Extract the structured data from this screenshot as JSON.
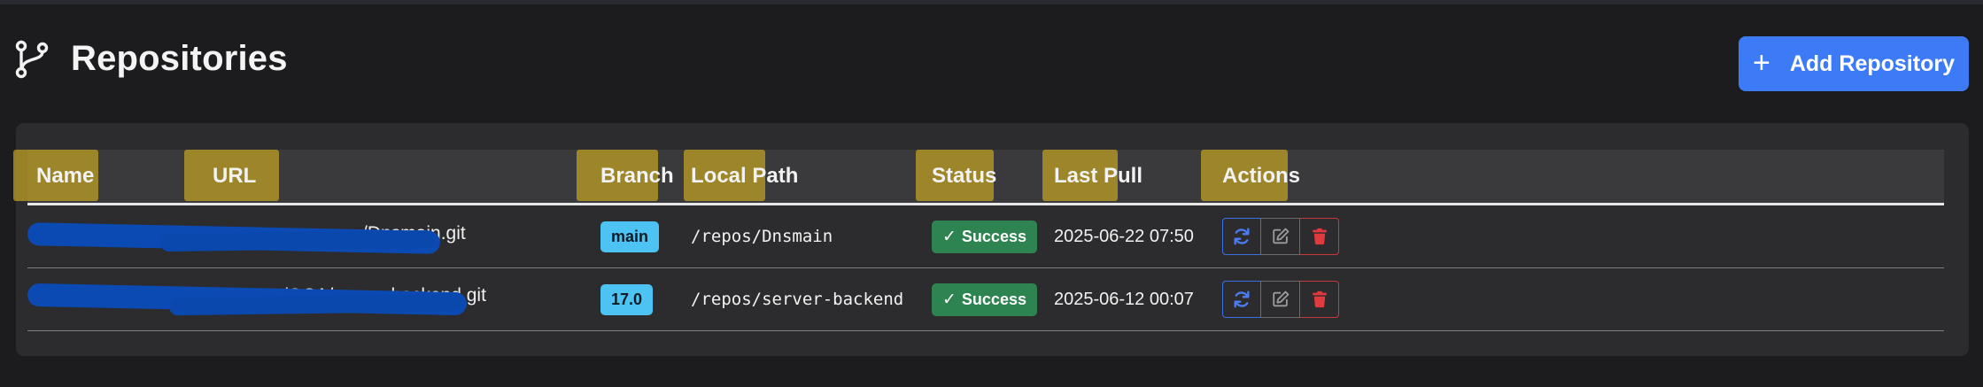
{
  "page": {
    "title": "Repositories"
  },
  "toolbar": {
    "add_label": "Add Repository"
  },
  "table": {
    "columns": [
      "Name",
      "URL",
      "Branch",
      "Local Path",
      "Status",
      "Last Pull",
      "Actions"
    ],
    "rows": [
      {
        "url_visible": "/Dnsmain.git",
        "branch": "main",
        "local_path": "/repos/Dnsmain",
        "status": "Success",
        "last_pull": "2025-06-22 07:50"
      },
      {
        "url_visible": "/OCA/server-backend.git",
        "branch": "17.0",
        "local_path": "/repos/server-backend",
        "status": "Success",
        "last_pull": "2025-06-12 00:07"
      }
    ]
  },
  "icons": {
    "title": "git-branch-icon",
    "add": "plus-icon",
    "status": "check-icon",
    "actions": [
      "refresh-icon",
      "edit-icon",
      "trash-icon"
    ]
  },
  "colors": {
    "background": "#1c1c1e",
    "card": "#2c2c2e",
    "primary": "#3d7bf6",
    "branch_badge": "#4cc3f2",
    "success": "#2e8451",
    "danger": "#e0393e",
    "highlight": "#c4a422",
    "redaction": "#0b4ab3"
  }
}
